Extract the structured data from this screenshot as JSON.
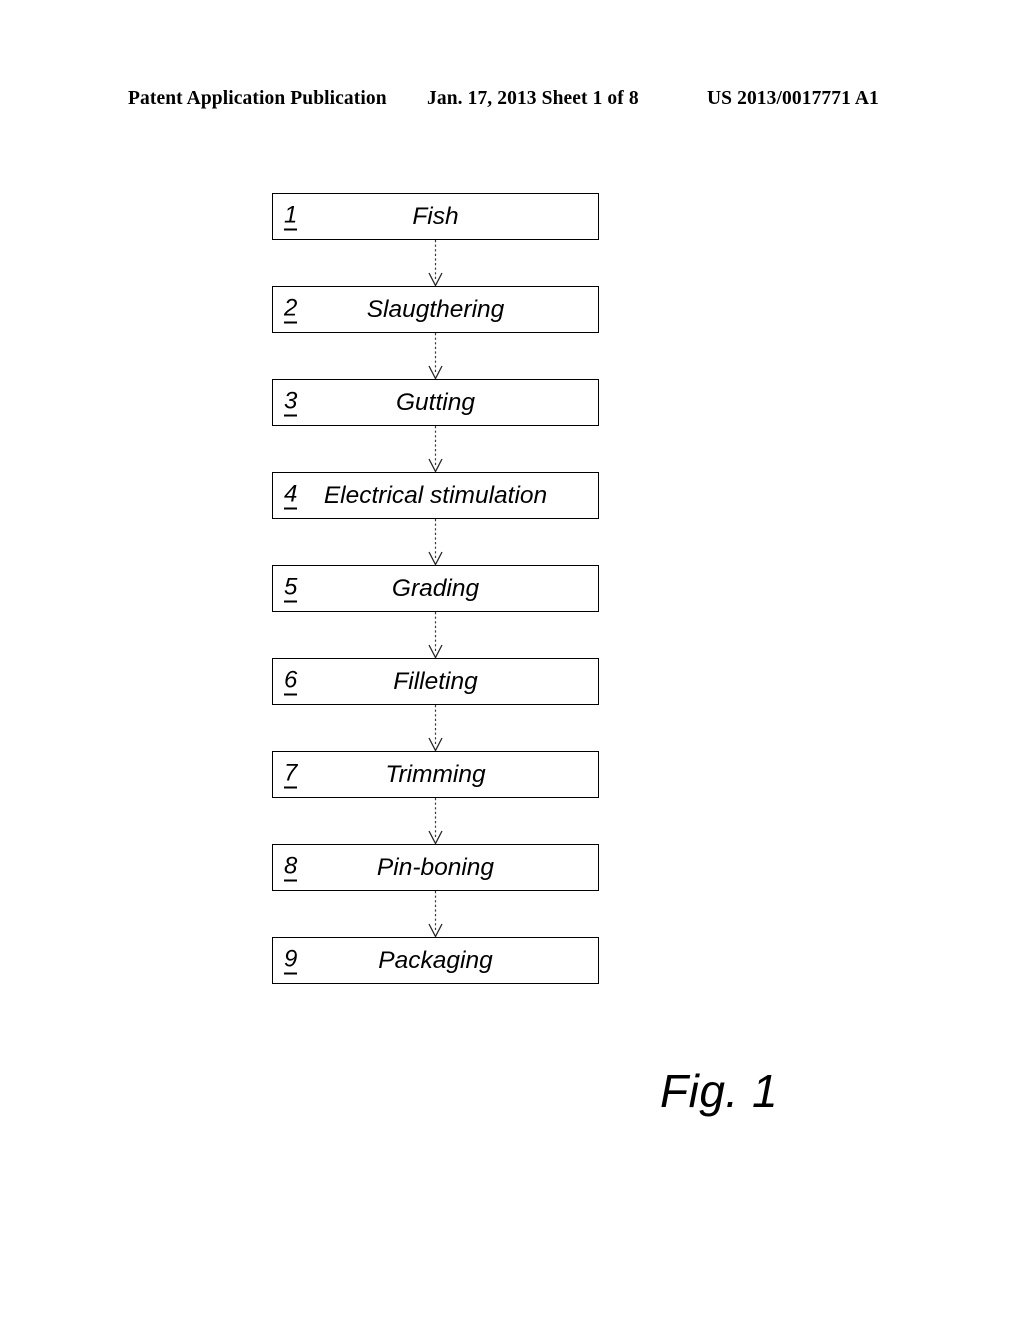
{
  "page": {
    "background_color": "#ffffff",
    "ink_color": "#000000"
  },
  "header": {
    "left": "Patent Application Publication",
    "middle": "Jan. 17, 2013  Sheet 1 of 8",
    "right": "US 2013/0017771 A1"
  },
  "figure": {
    "caption": "Fig. 1"
  },
  "flowchart": {
    "type": "process-flow",
    "orientation": "vertical",
    "connector": "dashed-arrow-down",
    "steps": [
      {
        "number": "1",
        "label": "Fish"
      },
      {
        "number": "2",
        "label": "Slaugthering"
      },
      {
        "number": "3",
        "label": "Gutting"
      },
      {
        "number": "4",
        "label": "Electrical stimulation"
      },
      {
        "number": "5",
        "label": "Grading"
      },
      {
        "number": "6",
        "label": "Filleting"
      },
      {
        "number": "7",
        "label": "Trimming"
      },
      {
        "number": "8",
        "label": "Pin-boning"
      },
      {
        "number": "9",
        "label": "Packaging"
      }
    ]
  }
}
